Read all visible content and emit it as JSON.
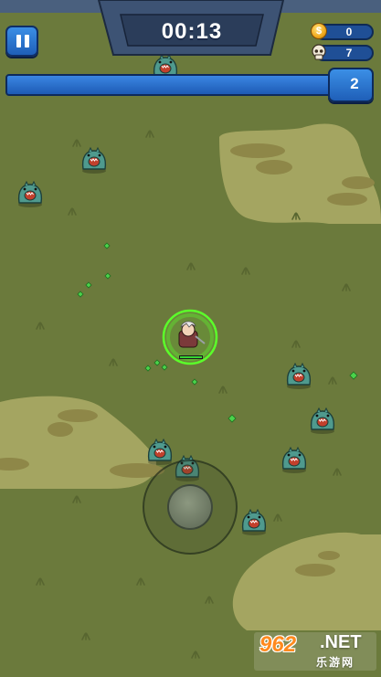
{
  "hud": {
    "timer": "00:13",
    "coins": "0",
    "kills": "7",
    "level": "2",
    "icons": {
      "pause": "pause-icon",
      "coin": "coin-icon",
      "coin_glyph": "$",
      "kills": "skull-icon"
    }
  },
  "watermark": {
    "number": "962",
    "suffix": ".NET",
    "chinese": "乐游网"
  },
  "colors": {
    "grass": "#6b7a3c",
    "sand": "#a4a561",
    "hud_blue": "#2a6fd0",
    "xp_ring": "#5bff2a",
    "monster": "#4f9a8e",
    "gem": "#4bd34b"
  }
}
